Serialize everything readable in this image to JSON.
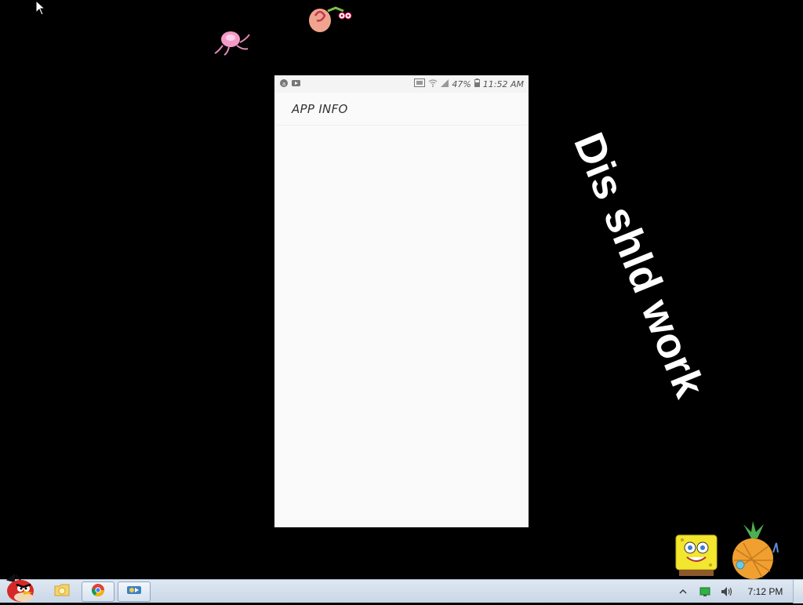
{
  "desktop": {
    "overlay_caption": "Dis shld work"
  },
  "phone": {
    "status_bar": {
      "battery_percent": "47%",
      "time": "11:52 AM",
      "left_icons": [
        "notification-icon",
        "video-icon"
      ],
      "right_icons": [
        "screen-cast-icon",
        "wifi-icon",
        "signal-icon",
        "battery-icon"
      ]
    },
    "app_bar": {
      "title": "APP INFO"
    }
  },
  "taskbar": {
    "start_icon": "angry-bird-icon",
    "pinned": [
      {
        "name": "file-explorer",
        "icon": "folder-icon"
      },
      {
        "name": "chrome",
        "icon": "chrome-icon",
        "active": true
      },
      {
        "name": "media-app",
        "icon": "media-icon",
        "active": true
      }
    ],
    "tray": {
      "icons": [
        "show-hidden-icons-icon",
        "network-icon",
        "volume-icon"
      ],
      "clock": "7:12 PM"
    }
  },
  "colors": {
    "desktop_bg": "#000000",
    "phone_bg": "#fafafa",
    "taskbar_top": "#dfe8f2",
    "taskbar_bottom": "#c8d6e6"
  }
}
